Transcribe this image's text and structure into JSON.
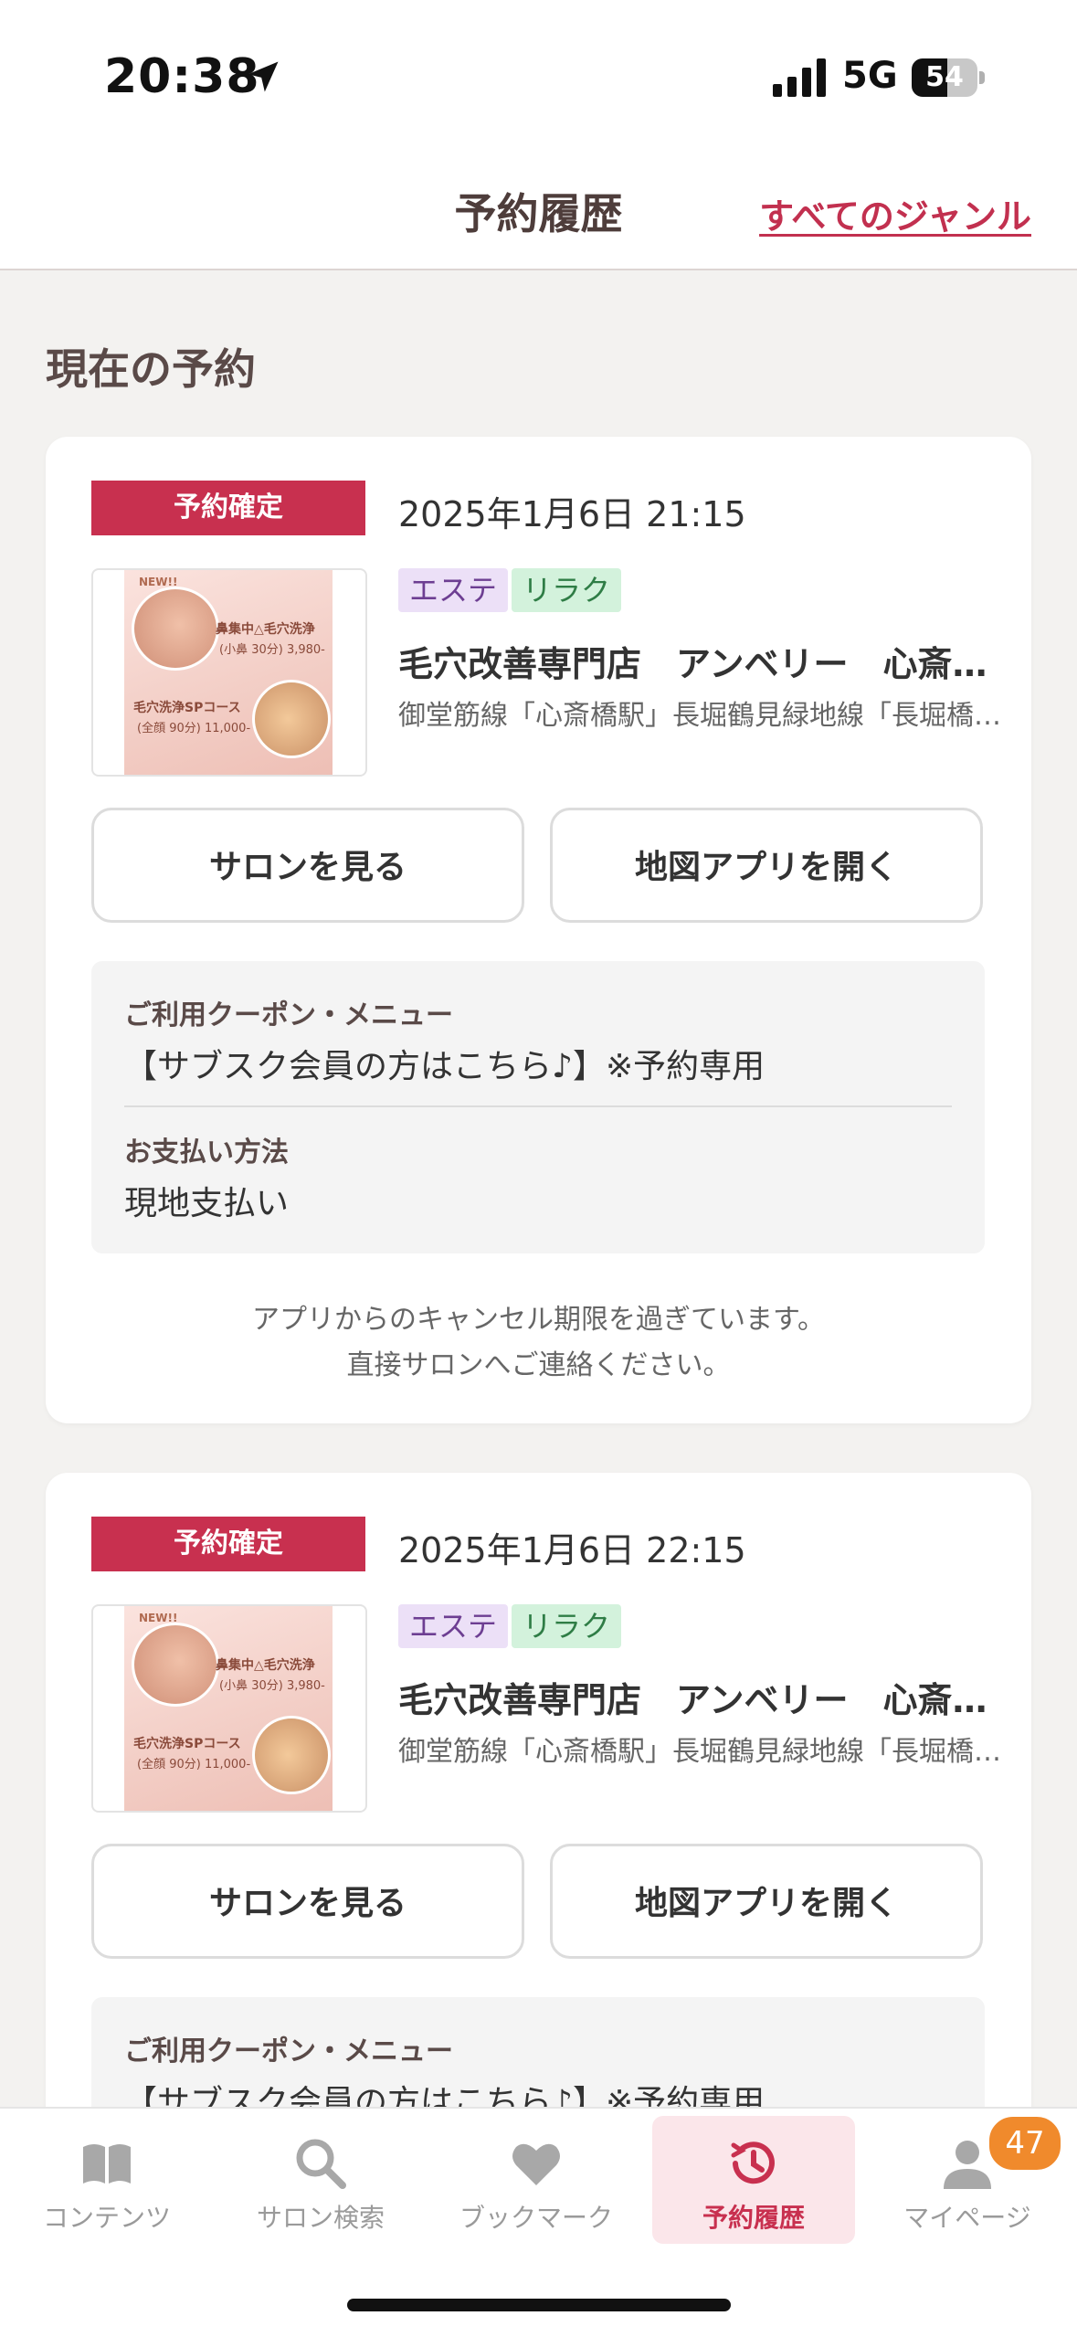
{
  "status_bar": {
    "time": "20:38",
    "network": "5G",
    "battery": "54",
    "battery_level": 0.54
  },
  "header": {
    "title": "予約履歴",
    "genre_link": "すべてのジャンル"
  },
  "section_title": "現在の予約",
  "reservations": [
    {
      "status": "予約確定",
      "datetime": "2025年1月6日 21:15",
      "tags": [
        "エステ",
        "リラク"
      ],
      "salon_name": "毛穴改善専門店　アンベリー　心斎橋店",
      "access": "御堂筋線「心斎橋駅」長堀鶴見緑地線「長堀橋駅」",
      "thumb_text": {
        "new": "NEW!!",
        "title": "鼻集中△毛穴洗浄",
        "price1": "(小鼻 30分) 3,980-",
        "course": "毛穴洗浄SPコース",
        "price2": "(全顔 90分) 11,000-"
      },
      "buttons": {
        "salon": "サロンを見る",
        "map": "地図アプリを開く"
      },
      "coupon_label": "ご利用クーポン・メニュー",
      "coupon_value": "【サブスク会員の方はこちら♪】※予約専用",
      "payment_label": "お支払い方法",
      "payment_value": "現地支払い",
      "cancel_note_1": "アプリからのキャンセル期限を過ぎています。",
      "cancel_note_2": "直接サロンへご連絡ください。"
    },
    {
      "status": "予約確定",
      "datetime": "2025年1月6日 22:15",
      "tags": [
        "エステ",
        "リラク"
      ],
      "salon_name": "毛穴改善専門店　アンベリー　心斎橋店",
      "access": "御堂筋線「心斎橋駅」長堀鶴見緑地線「長堀橋駅」",
      "thumb_text": {
        "new": "NEW!!",
        "title": "鼻集中△毛穴洗浄",
        "price1": "(小鼻 30分) 3,980-",
        "course": "毛穴洗浄SPコース",
        "price2": "(全顔 90分) 11,000-"
      },
      "buttons": {
        "salon": "サロンを見る",
        "map": "地図アプリを開く"
      },
      "coupon_label": "ご利用クーポン・メニュー",
      "coupon_value": "【サブスク会員の方はこちら♪】※予約専用"
    }
  ],
  "tabbar": {
    "items": [
      {
        "label": "コンテンツ",
        "icon": "book-icon"
      },
      {
        "label": "サロン検索",
        "icon": "search-icon"
      },
      {
        "label": "ブックマーク",
        "icon": "heart-icon"
      },
      {
        "label": "予約履歴",
        "icon": "clock-history-icon",
        "active": true
      },
      {
        "label": "マイページ",
        "icon": "person-icon"
      }
    ],
    "mypage_badge": "47"
  },
  "colors": {
    "accent": "#c8304f",
    "badge_orange": "#f08a2c",
    "background": "#f3f2f0"
  }
}
